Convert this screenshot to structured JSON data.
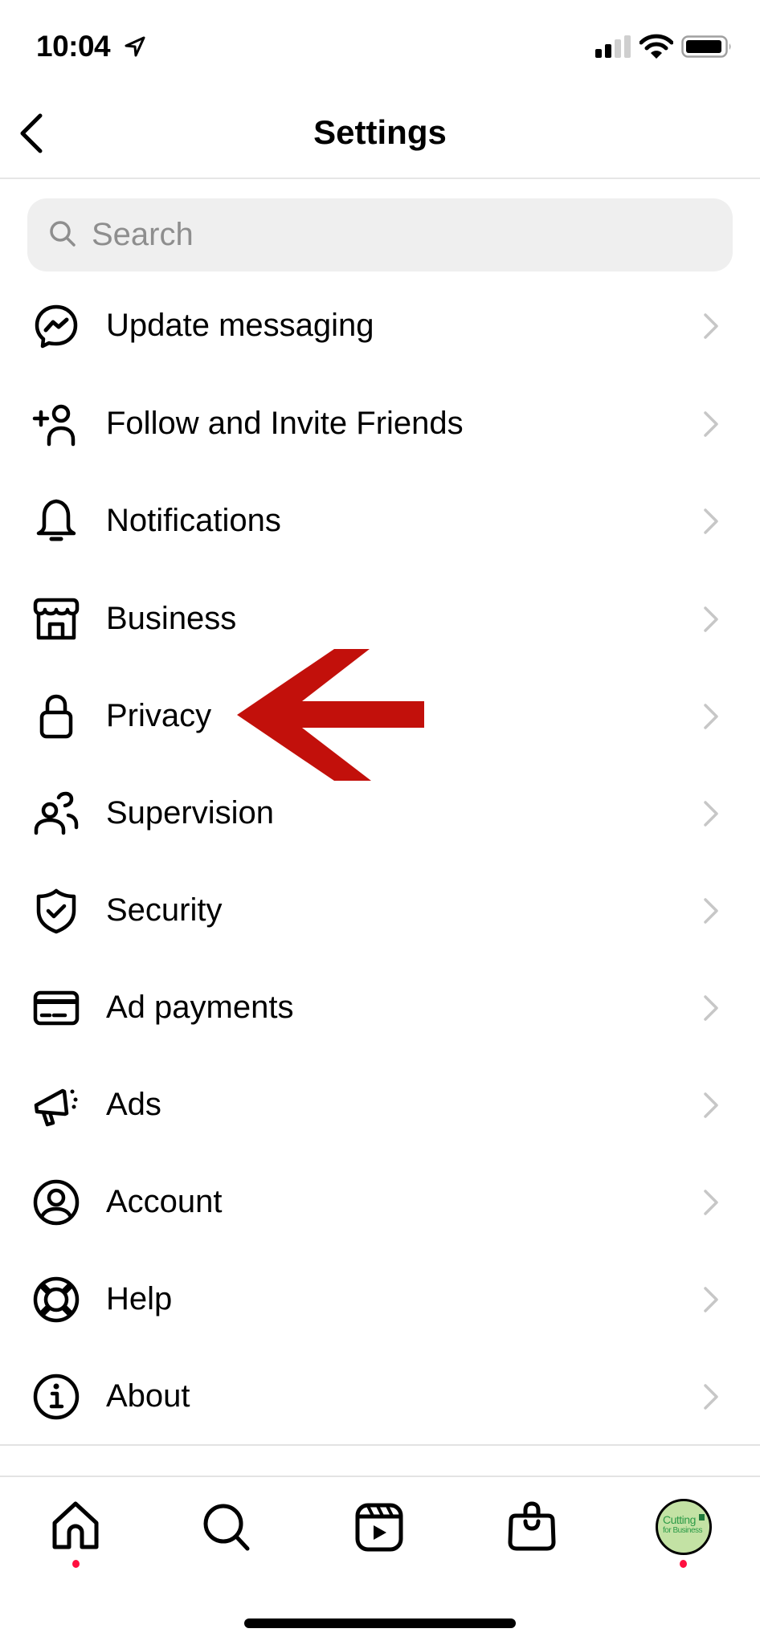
{
  "status_bar": {
    "time": "10:04",
    "location_icon": "location-arrow-icon",
    "signal_bars_active": 2,
    "signal_bars_total": 4,
    "wifi_icon": "wifi-icon",
    "battery_icon": "battery-icon"
  },
  "header": {
    "title": "Settings",
    "back_icon": "chevron-left-icon"
  },
  "search": {
    "placeholder": "Search",
    "value": "",
    "icon": "search-icon"
  },
  "menu": {
    "items": [
      {
        "label": "Update messaging",
        "icon": "messenger-icon"
      },
      {
        "label": "Follow and Invite Friends",
        "icon": "add-person-icon"
      },
      {
        "label": "Notifications",
        "icon": "bell-icon"
      },
      {
        "label": "Business",
        "icon": "storefront-icon"
      },
      {
        "label": "Privacy",
        "icon": "lock-icon"
      },
      {
        "label": "Supervision",
        "icon": "people-icon"
      },
      {
        "label": "Security",
        "icon": "shield-check-icon"
      },
      {
        "label": "Ad payments",
        "icon": "credit-card-icon"
      },
      {
        "label": "Ads",
        "icon": "megaphone-icon"
      },
      {
        "label": "Account",
        "icon": "user-circle-icon"
      },
      {
        "label": "Help",
        "icon": "lifebuoy-icon"
      },
      {
        "label": "About",
        "icon": "info-icon"
      }
    ]
  },
  "annotation": {
    "arrow_icon": "red-arrow-left-icon",
    "arrow_color": "#c2100b",
    "points_to": "Privacy"
  },
  "bottom_nav": {
    "items": [
      {
        "name": "home",
        "icon": "home-icon",
        "badge": true
      },
      {
        "name": "search",
        "icon": "search-icon",
        "badge": false
      },
      {
        "name": "reels",
        "icon": "reels-icon",
        "badge": false
      },
      {
        "name": "shop",
        "icon": "shopping-bag-icon",
        "badge": false
      },
      {
        "name": "profile",
        "icon": "avatar",
        "badge": true
      }
    ],
    "avatar_text_line1": "Cutting",
    "avatar_text_line2": "for Business",
    "badge_color": "#ff0f3f"
  }
}
